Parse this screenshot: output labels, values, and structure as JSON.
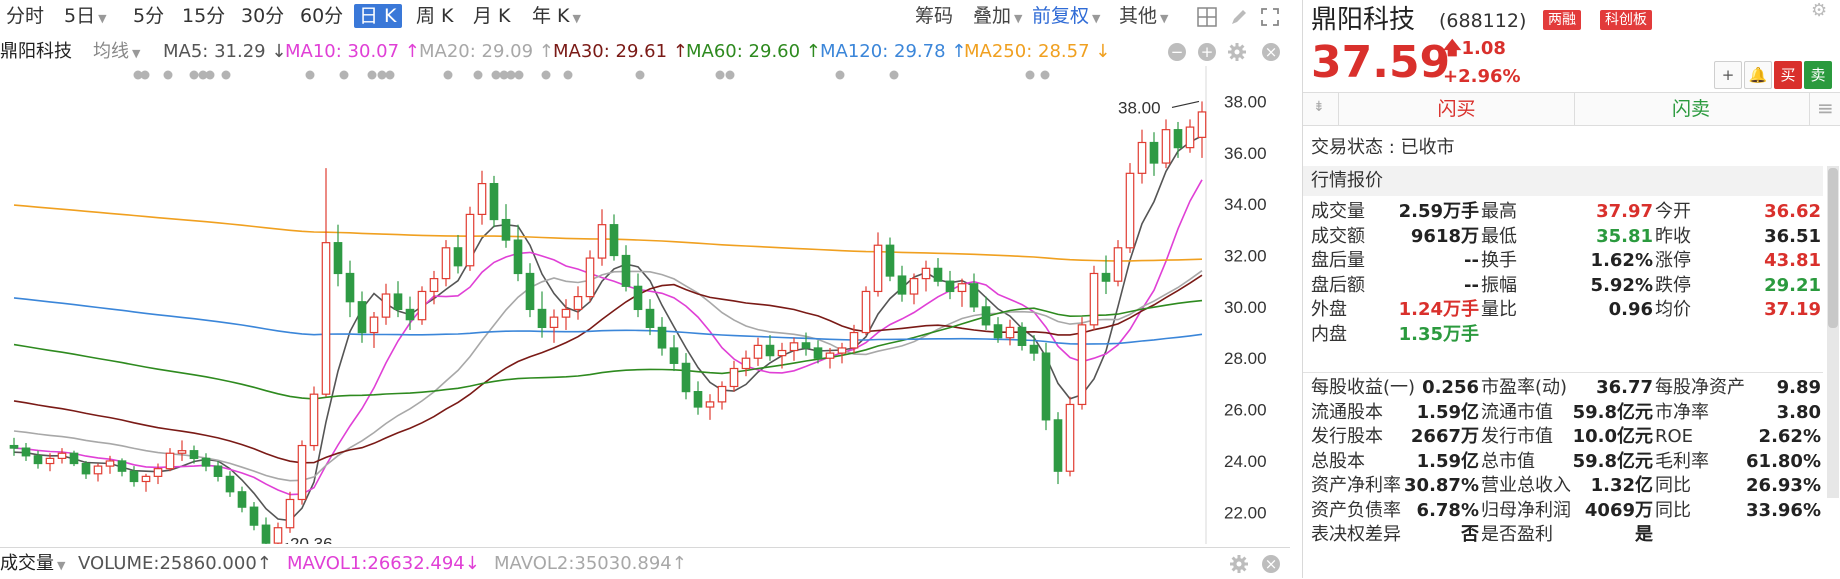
{
  "toolbar": {
    "periods": [
      "分时",
      "5日",
      "5分",
      "15分",
      "30分",
      "60分",
      "日 K",
      "周 K",
      "月 K",
      "年 K"
    ],
    "active_period": "日 K",
    "right_items": [
      "筹码",
      "叠加",
      "前复权",
      "其他"
    ]
  },
  "legend": {
    "stock_name": "鼎阳科技",
    "line_type": "均线",
    "ma5": "MA5: 31.29 ↓",
    "ma10": "MA10: 30.07 ↑",
    "ma20": "MA20: 29.09 ↑",
    "ma30": "MA30: 29.61 ↑",
    "ma60": "MA60: 29.60 ↑",
    "ma120": "MA120: 29.78 ↑",
    "ma250": "MA250: 28.57 ↓"
  },
  "colors": {
    "up": "#e03c31",
    "down": "#2e9a44",
    "ma5": "#555555",
    "ma10": "#e040d6",
    "ma20": "#a8a8a8",
    "ma30": "#7a1a16",
    "ma60": "#2e8a1f",
    "ma120": "#3b86d9",
    "ma250": "#f0a020"
  },
  "chart_data": {
    "type": "candlestick",
    "y_ticks": [
      "38.00",
      "36.00",
      "34.00",
      "32.00",
      "30.00",
      "28.00",
      "26.00",
      "24.00",
      "22.00"
    ],
    "ylim": [
      21,
      38.6
    ],
    "high_label": "38.00",
    "low_label": "20.36",
    "candles": [
      [
        24.6,
        24.9,
        24.2,
        24.5
      ],
      [
        24.5,
        24.7,
        24.0,
        24.2
      ],
      [
        24.2,
        24.4,
        23.7,
        23.9
      ],
      [
        23.9,
        24.3,
        23.6,
        24.1
      ],
      [
        24.1,
        24.5,
        23.9,
        24.3
      ],
      [
        24.3,
        24.4,
        23.8,
        23.9
      ],
      [
        23.9,
        24.0,
        23.3,
        23.5
      ],
      [
        23.5,
        23.9,
        23.2,
        23.8
      ],
      [
        23.8,
        24.2,
        23.5,
        24.0
      ],
      [
        24.0,
        24.1,
        23.4,
        23.6
      ],
      [
        23.6,
        23.8,
        23.0,
        23.2
      ],
      [
        23.2,
        23.5,
        22.8,
        23.4
      ],
      [
        23.4,
        23.9,
        23.1,
        23.7
      ],
      [
        23.7,
        24.5,
        23.6,
        24.3
      ],
      [
        24.3,
        24.8,
        24.0,
        24.4
      ],
      [
        24.4,
        24.6,
        23.9,
        24.1
      ],
      [
        24.1,
        24.3,
        23.6,
        23.8
      ],
      [
        23.8,
        24.0,
        23.2,
        23.4
      ],
      [
        23.4,
        23.6,
        22.6,
        22.8
      ],
      [
        22.8,
        23.0,
        22.0,
        22.2
      ],
      [
        22.2,
        22.4,
        21.3,
        21.5
      ],
      [
        21.5,
        21.8,
        20.4,
        20.8
      ],
      [
        20.8,
        21.6,
        20.5,
        21.4
      ],
      [
        21.4,
        22.8,
        21.2,
        22.5
      ],
      [
        22.5,
        24.8,
        22.3,
        24.6
      ],
      [
        24.6,
        26.9,
        24.4,
        26.6
      ],
      [
        26.6,
        35.4,
        26.5,
        32.5
      ],
      [
        32.5,
        33.2,
        30.8,
        31.3
      ],
      [
        31.3,
        31.8,
        29.6,
        30.2
      ],
      [
        30.2,
        30.6,
        28.6,
        29.0
      ],
      [
        29.0,
        29.8,
        28.4,
        29.6
      ],
      [
        29.6,
        30.9,
        29.3,
        30.5
      ],
      [
        30.5,
        31.0,
        29.6,
        29.9
      ],
      [
        29.9,
        30.4,
        29.1,
        29.5
      ],
      [
        29.5,
        30.8,
        29.3,
        30.6
      ],
      [
        30.6,
        31.4,
        30.1,
        31.1
      ],
      [
        31.1,
        32.6,
        30.8,
        32.3
      ],
      [
        32.3,
        32.8,
        31.3,
        31.6
      ],
      [
        31.6,
        33.9,
        31.4,
        33.6
      ],
      [
        33.6,
        35.3,
        33.2,
        34.8
      ],
      [
        34.8,
        35.1,
        33.1,
        33.4
      ],
      [
        33.4,
        34.0,
        32.3,
        32.6
      ],
      [
        32.6,
        33.2,
        31.0,
        31.3
      ],
      [
        31.3,
        31.7,
        29.6,
        29.9
      ],
      [
        29.9,
        30.6,
        28.8,
        29.2
      ],
      [
        29.2,
        29.9,
        28.6,
        29.6
      ],
      [
        29.6,
        30.3,
        29.1,
        29.9
      ],
      [
        29.9,
        30.8,
        29.5,
        30.4
      ],
      [
        30.4,
        32.2,
        30.2,
        31.9
      ],
      [
        31.9,
        33.8,
        31.6,
        33.2
      ],
      [
        33.2,
        33.6,
        31.8,
        32.0
      ],
      [
        32.0,
        32.4,
        30.6,
        30.8
      ],
      [
        30.8,
        31.3,
        29.6,
        29.9
      ],
      [
        29.9,
        30.3,
        28.9,
        29.2
      ],
      [
        29.2,
        29.6,
        28.1,
        28.4
      ],
      [
        28.4,
        28.9,
        27.5,
        27.8
      ],
      [
        27.8,
        28.2,
        26.4,
        26.7
      ],
      [
        26.7,
        27.1,
        25.8,
        26.1
      ],
      [
        26.1,
        26.6,
        25.6,
        26.3
      ],
      [
        26.3,
        27.1,
        26.0,
        26.9
      ],
      [
        26.9,
        27.9,
        26.7,
        27.6
      ],
      [
        27.6,
        28.3,
        27.3,
        28.0
      ],
      [
        28.0,
        28.8,
        27.7,
        28.5
      ],
      [
        28.5,
        28.9,
        27.9,
        28.1
      ],
      [
        28.1,
        28.6,
        27.6,
        28.3
      ],
      [
        28.3,
        28.8,
        27.9,
        28.6
      ],
      [
        28.6,
        29.0,
        28.1,
        28.4
      ],
      [
        28.4,
        28.7,
        27.8,
        28.0
      ],
      [
        28.0,
        28.4,
        27.6,
        28.2
      ],
      [
        28.2,
        28.6,
        27.8,
        28.4
      ],
      [
        28.4,
        29.3,
        28.2,
        29.0
      ],
      [
        29.0,
        30.8,
        28.9,
        30.6
      ],
      [
        30.6,
        32.9,
        30.4,
        32.4
      ],
      [
        32.4,
        32.7,
        31.0,
        31.2
      ],
      [
        31.2,
        31.6,
        30.2,
        30.5
      ],
      [
        30.5,
        31.3,
        30.1,
        31.1
      ],
      [
        31.1,
        31.8,
        30.6,
        31.5
      ],
      [
        31.5,
        31.9,
        30.8,
        31.0
      ],
      [
        31.0,
        31.4,
        30.3,
        30.6
      ],
      [
        30.6,
        31.1,
        30.0,
        30.9
      ],
      [
        30.9,
        31.3,
        29.8,
        30.0
      ],
      [
        30.0,
        30.4,
        29.1,
        29.3
      ],
      [
        29.3,
        29.6,
        28.6,
        28.8
      ],
      [
        28.8,
        29.5,
        28.5,
        29.2
      ],
      [
        29.2,
        29.4,
        28.3,
        28.5
      ],
      [
        28.5,
        28.9,
        27.9,
        28.2
      ],
      [
        28.2,
        28.6,
        25.2,
        25.6
      ],
      [
        25.6,
        25.9,
        23.1,
        23.6
      ],
      [
        23.6,
        26.5,
        23.4,
        26.2
      ],
      [
        26.2,
        29.6,
        26.0,
        29.3
      ],
      [
        29.3,
        31.6,
        29.1,
        31.3
      ],
      [
        31.3,
        32.0,
        30.5,
        31.0
      ],
      [
        31.0,
        32.6,
        30.8,
        32.3
      ],
      [
        32.3,
        35.6,
        32.1,
        35.2
      ],
      [
        35.2,
        36.9,
        34.8,
        36.4
      ],
      [
        36.4,
        36.8,
        35.1,
        35.6
      ],
      [
        35.6,
        37.3,
        35.4,
        36.9
      ],
      [
        36.9,
        37.2,
        35.8,
        36.2
      ],
      [
        36.2,
        37.3,
        36.0,
        37.0
      ],
      [
        36.6,
        38.0,
        35.8,
        37.59
      ]
    ]
  },
  "volume_bar": {
    "label": "成交量",
    "volume": "VOLUME:25860.000↑",
    "mavol1": "MAVOL1:26632.494↓",
    "mavol2": "MAVOL2:35030.894↑"
  },
  "stock": {
    "name": "鼎阳科技",
    "code": "(688112)",
    "tags": [
      "两融",
      "科创板"
    ],
    "price": "37.59",
    "change": "1.08",
    "change_pct": "+2.96%",
    "flash_buy": "闪买",
    "flash_sell": "闪卖",
    "buy_btn": "买",
    "sell_btn": "卖",
    "add_btn": "+",
    "status_label": "交易状态 : 已收市",
    "section_title": "行情报价"
  },
  "quotes": [
    [
      [
        "成交量",
        "2.59万手",
        "dark"
      ],
      [
        "最高",
        "37.97",
        "red"
      ],
      [
        "今开",
        "36.62",
        "red"
      ]
    ],
    [
      [
        "成交额",
        "9618万",
        "dark"
      ],
      [
        "最低",
        "35.81",
        "green"
      ],
      [
        "昨收",
        "36.51",
        "dark"
      ]
    ],
    [
      [
        "盘后量",
        "--",
        "dark"
      ],
      [
        "换手",
        "1.62%",
        "dark"
      ],
      [
        "涨停",
        "43.81",
        "red"
      ]
    ],
    [
      [
        "盘后额",
        "--",
        "dark"
      ],
      [
        "振幅",
        "5.92%",
        "dark"
      ],
      [
        "跌停",
        "29.21",
        "green"
      ]
    ],
    [
      [
        "外盘",
        "1.24万手",
        "red"
      ],
      [
        "量比",
        "0.96",
        "dark"
      ],
      [
        "均价",
        "37.19",
        "red"
      ]
    ],
    [
      [
        "内盘",
        "1.35万手",
        "green"
      ],
      [
        "",
        "",
        " "
      ],
      [
        "",
        "",
        " "
      ]
    ]
  ],
  "fundamentals": [
    [
      [
        "每股收益(一)",
        "0.256"
      ],
      [
        "市盈率(动)",
        "36.77"
      ],
      [
        "每股净资产",
        "9.89"
      ]
    ],
    [
      [
        "流通股本",
        "1.59亿"
      ],
      [
        "流通市值",
        "59.8亿元"
      ],
      [
        "市净率",
        "3.80"
      ]
    ],
    [
      [
        "发行股本",
        "2667万"
      ],
      [
        "发行市值",
        "10.0亿元"
      ],
      [
        "ROE",
        "2.62%"
      ]
    ],
    [
      [
        "总股本",
        "1.59亿"
      ],
      [
        "总市值",
        "59.8亿元"
      ],
      [
        "毛利率",
        "61.80%"
      ]
    ],
    [
      [
        "资产净利率",
        "30.87%"
      ],
      [
        "营业总收入",
        "1.32亿"
      ],
      [
        "同比",
        "26.93%"
      ]
    ],
    [
      [
        "资产负债率",
        "6.78%"
      ],
      [
        "归母净利润",
        "4069万"
      ],
      [
        "同比",
        "33.96%"
      ]
    ],
    [
      [
        "表决权差异",
        "否"
      ],
      [
        "是否盈利",
        "是"
      ],
      [
        "",
        ""
      ]
    ]
  ]
}
